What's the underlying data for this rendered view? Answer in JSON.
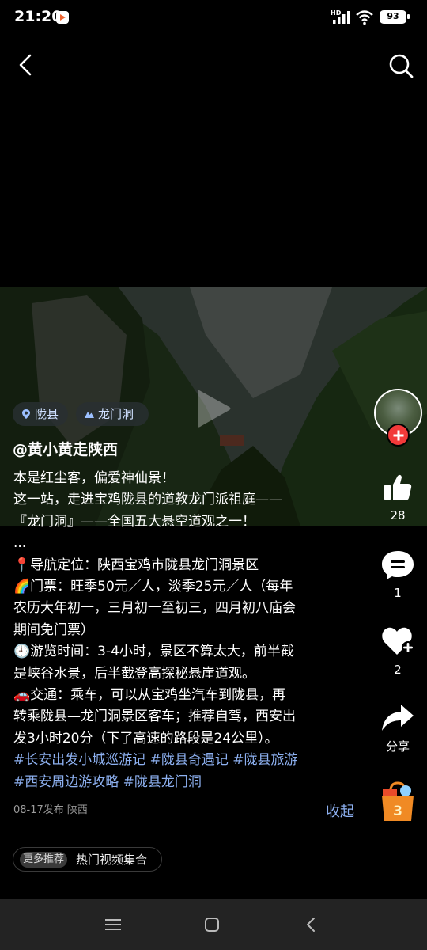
{
  "status_bar": {
    "time": "21:20",
    "network": "HD",
    "battery": "93"
  },
  "video": {
    "locations": [
      {
        "label": "陇县",
        "icon": "location-pin-icon"
      },
      {
        "label": "龙门洞",
        "icon": "mountain-icon"
      }
    ]
  },
  "post": {
    "author": "@黄小黄走陕西",
    "description_lines": [
      "本是红尘客，偏爱神仙景！",
      "这一站，走进宝鸡陇县的道教龙门派祖庭——",
      "『龙门洞』——全国五大悬空道观之一！",
      "...",
      "📍导航定位：陕西宝鸡市陇县龙门洞景区",
      "🌈门票：旺季50元／人，淡季25元／人（每年",
      "农历大年初一，三月初一至初三，四月初八庙会",
      "期间免门票）",
      "🕘游览时间：3-4小时，景区不算太大，前半截",
      "是峡谷水景，后半截登高探秘悬崖道观。",
      "🚗交通：乘车，可以从宝鸡坐汽车到陇县，再",
      "转乘陇县—龙门洞景区客车；推荐自驾，西安出",
      "发3小时20分（下了高速的路段是24公里）。"
    ],
    "hashtag_lines": [
      "#长安出发小城巡游记 #陇县奇遇记 #陇县旅游",
      "#西安周边游攻略 #陇县龙门洞"
    ],
    "meta": "08-17发布 陕西",
    "collapse_label": "收起"
  },
  "more": {
    "badge": "更多推荐",
    "label": "热门视频集合"
  },
  "actions": {
    "like_count": "28",
    "comment_count": "1",
    "collect_count": "2",
    "share_label": "分享",
    "shop_badge": "3"
  },
  "colors": {
    "accent_link": "#8db0f0",
    "follow_red": "#f23a3a",
    "shop_orange": "#f08a24"
  }
}
